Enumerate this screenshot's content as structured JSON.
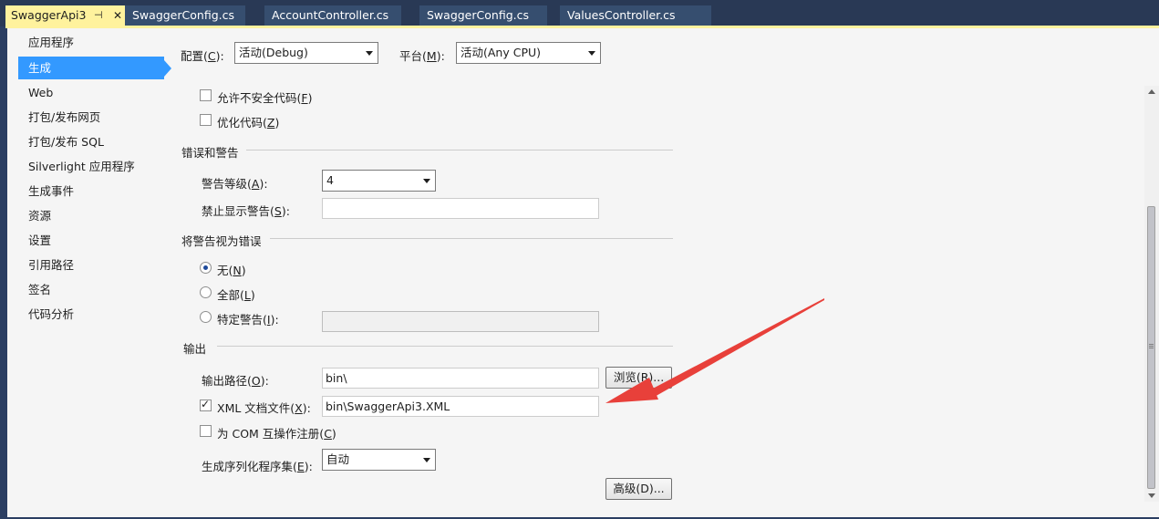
{
  "tabs": [
    {
      "label": "SwaggerApi3",
      "pin": "⊣",
      "close": "✕",
      "active": true
    },
    {
      "label": "SwaggerConfig.cs"
    },
    {
      "label": "AccountController.cs"
    },
    {
      "label": "SwaggerConfig.cs"
    },
    {
      "label": "ValuesController.cs"
    }
  ],
  "nav": {
    "items": [
      "应用程序",
      "生成",
      "Web",
      "打包/发布网页",
      "打包/发布 SQL",
      "Silverlight 应用程序",
      "生成事件",
      "资源",
      "设置",
      "引用路径",
      "签名",
      "代码分析"
    ],
    "selected": "生成"
  },
  "header": {
    "config_label": "配置(",
    "config_key": "C",
    "config_tail": "):",
    "config_value": "活动(Debug)",
    "platform_label": "平台(",
    "platform_key": "M",
    "platform_tail": "):",
    "platform_value": "活动(Any CPU)"
  },
  "general": {
    "unsafe_label": "允许不安全代码(",
    "unsafe_key": "F",
    "optimize_label": "优化代码(",
    "optimize_key": "Z",
    "close_paren": ")"
  },
  "errors": {
    "section_title": "错误和警告",
    "level_label": "警告等级(",
    "level_key": "A",
    "level_value": "4",
    "suppress_label": "禁止显示警告(",
    "suppress_key": "S",
    "suppress_value": ""
  },
  "treat": {
    "section_title": "将警告视为错误",
    "none_label": "无(",
    "none_key": "N",
    "all_label": "全部(",
    "all_key": "L",
    "specific_label": "特定警告(",
    "specific_key": "I",
    "specific_value": ""
  },
  "output": {
    "section_title": "输出",
    "path_label": "输出路径(",
    "path_key": "O",
    "path_value": "bin\\",
    "browse_label": "浏览(R)...",
    "xml_label": "XML 文档文件(",
    "xml_key": "X",
    "xml_value": "bin\\SwaggerApi3.XML",
    "xml_checked": true,
    "com_label": "为 COM 互操作注册(",
    "com_key": "C",
    "serial_label": "生成序列化程序集(",
    "serial_key": "E",
    "serial_value": "自动",
    "advanced_label": "高级(D)..."
  },
  "colors": {
    "tab_active": "#fff29d",
    "nav_selected": "#3399ff",
    "annotation_arrow": "#e8403a"
  }
}
